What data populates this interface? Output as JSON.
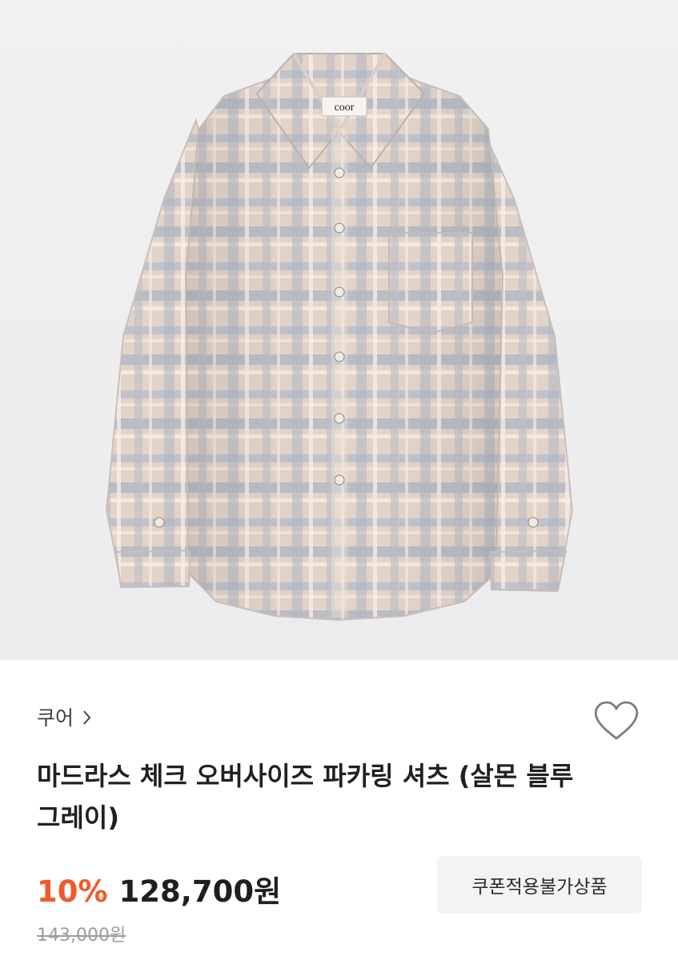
{
  "image": {
    "alt": "coor"
  },
  "brand": {
    "name": "쿠어"
  },
  "product": {
    "title": "마드라스 체크 오버사이즈 파카링 셔츠 (살몬 블루그레이)",
    "discount_rate": "10%",
    "sale_price": "128,700원",
    "original_price": "143,000원",
    "coupon_status": "쿠폰적용불가상품"
  },
  "colors": {
    "discount": "#f15a28",
    "text_primary": "#1f1f1f",
    "text_secondary": "#9d9d9d",
    "badge_bg": "#f3f3f4"
  },
  "icons": {
    "brand_chevron": "chevron-right-icon",
    "wishlist": "heart-outline-icon"
  }
}
